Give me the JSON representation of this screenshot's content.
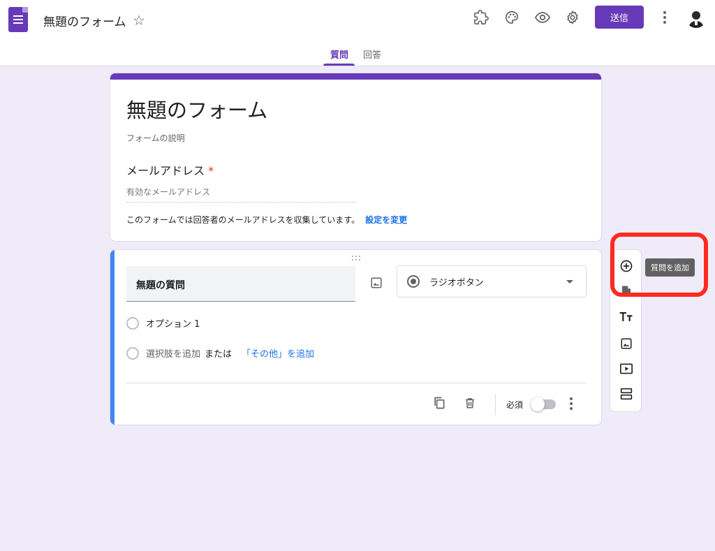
{
  "header": {
    "doc_title": "無題のフォーム",
    "send_label": "送信"
  },
  "tabs": [
    {
      "label": "質問"
    },
    {
      "label": "回答"
    }
  ],
  "title_card": {
    "form_title": "無題のフォーム",
    "description_placeholder": "フォームの説明",
    "email_label": "メールアドレス",
    "required_mark": "*",
    "email_placeholder": "有効なメールアドレス",
    "notice": "このフォームでは回答者のメールアドレスを収集しています。",
    "settings_link": "設定を変更"
  },
  "question_card": {
    "question_title": "無題の質問",
    "question_type": "ラジオボタン",
    "option1": "オプション 1",
    "add_option": "選択肢を追加",
    "or_text": "または",
    "add_other": "「その他」を追加",
    "required_label": "必須",
    "required_on": false
  },
  "tooltip": "質問を追加",
  "colors": {
    "accent": "#673ab7",
    "background": "#f0ebf8",
    "active_question_bar": "#4285f4",
    "annotation": "#ff2a1f",
    "link": "#1a73e8"
  }
}
